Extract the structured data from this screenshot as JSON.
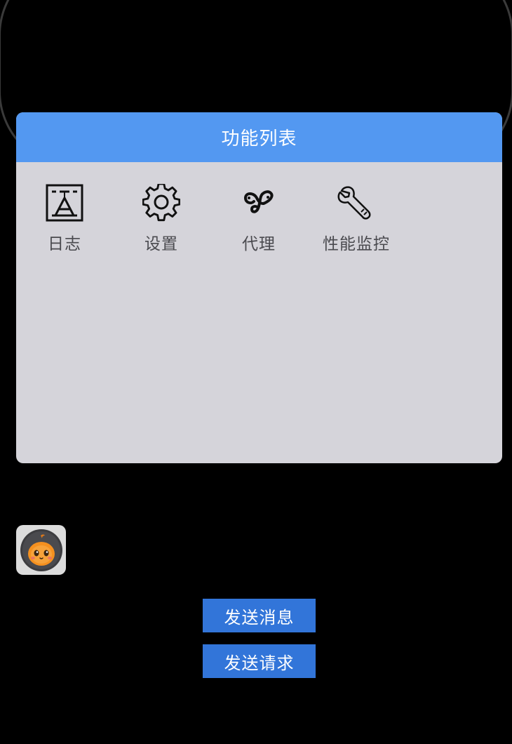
{
  "panel": {
    "title": "功能列表",
    "header_color": "#5398f1",
    "background_color": "#d5d4da",
    "tools": [
      {
        "label": "日志",
        "icon": "log-icon"
      },
      {
        "label": "设置",
        "icon": "gear-icon"
      },
      {
        "label": "代理",
        "icon": "proxy-icon"
      },
      {
        "label": "性能监控",
        "icon": "wrench-icon"
      }
    ]
  },
  "floating_button": {
    "icon": "pumpkin-mascot-icon"
  },
  "actions": {
    "send_message_label": "发送消息",
    "send_request_label": "发送请求",
    "button_color": "#3275d9"
  }
}
